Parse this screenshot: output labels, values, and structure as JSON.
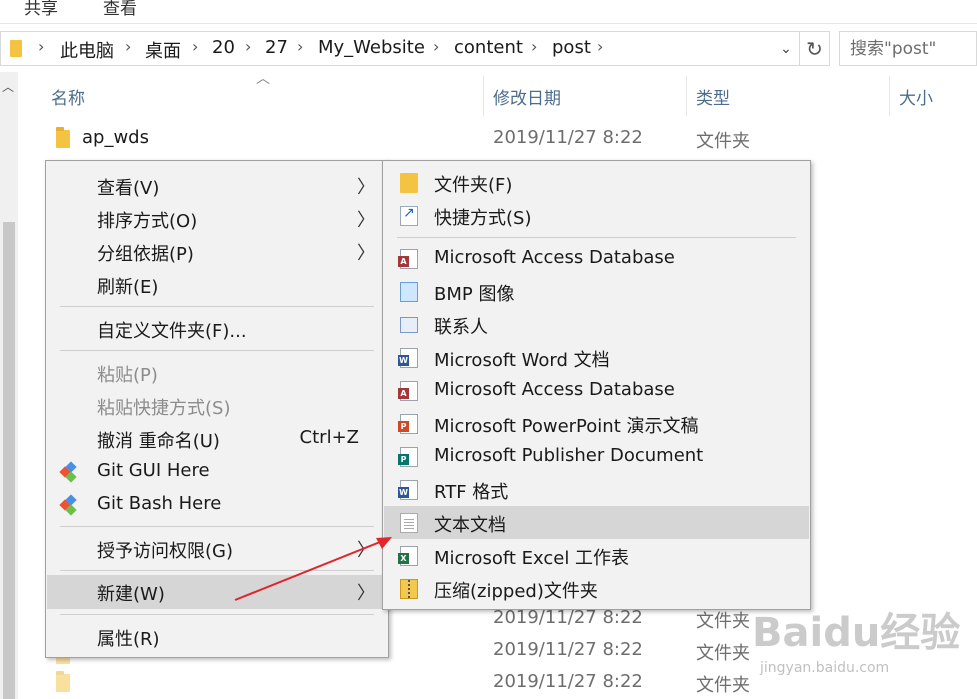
{
  "ribbon": {
    "tabs": [
      "共享",
      "查看"
    ]
  },
  "address": {
    "crumbs": [
      "此电脑",
      "桌面",
      "20",
      "27",
      "My_Website",
      "content",
      "post"
    ]
  },
  "search": {
    "placeholder": "搜索\"post\""
  },
  "columns": {
    "name": "名称",
    "date": "修改日期",
    "type": "类型",
    "size": "大小"
  },
  "files": [
    {
      "name": "ap_wds",
      "date": "2019/11/27 8:22",
      "type": "文件夹"
    },
    {
      "name": "",
      "date": "2019/11/27 8:22",
      "type": "文件夹"
    },
    {
      "name": "",
      "date": "2019/11/27 8:22",
      "type": "文件夹"
    },
    {
      "name": "",
      "date": "2019/11/27 8:22",
      "type": "文件夹"
    }
  ],
  "context_menu": {
    "view": "查看(V)",
    "sort": "排序方式(O)",
    "group": "分组依据(P)",
    "refresh": "刷新(E)",
    "customize": "自定义文件夹(F)...",
    "paste": "粘贴(P)",
    "paste_shortcut": "粘贴快捷方式(S)",
    "undo": "撤消 重命名(U)",
    "undo_shortcut": "Ctrl+Z",
    "git_gui": "Git GUI Here",
    "git_bash": "Git Bash Here",
    "give_access": "授予访问权限(G)",
    "new": "新建(W)",
    "properties": "属性(R)"
  },
  "new_submenu": {
    "folder": "文件夹(F)",
    "shortcut": "快捷方式(S)",
    "items": [
      {
        "label": "Microsoft Access Database",
        "icon": "access-icon",
        "badge": "A",
        "color": "#a4373a"
      },
      {
        "label": "BMP 图像",
        "icon": "bmp-icon"
      },
      {
        "label": "联系人",
        "icon": "contact-icon"
      },
      {
        "label": "Microsoft Word 文档",
        "icon": "word-icon",
        "badge": "W",
        "color": "#2b579a"
      },
      {
        "label": "Microsoft Access Database",
        "icon": "access-icon",
        "badge": "A",
        "color": "#a4373a"
      },
      {
        "label": "Microsoft PowerPoint 演示文稿",
        "icon": "powerpoint-icon",
        "badge": "P",
        "color": "#d24726"
      },
      {
        "label": "Microsoft Publisher Document",
        "icon": "publisher-icon",
        "badge": "P",
        "color": "#077568"
      },
      {
        "label": "RTF 格式",
        "icon": "rtf-icon",
        "badge": "W",
        "color": "#2b579a"
      },
      {
        "label": "文本文档",
        "icon": "text-document-icon"
      },
      {
        "label": "Microsoft Excel 工作表",
        "icon": "excel-icon",
        "badge": "X",
        "color": "#217346"
      },
      {
        "label": "压缩(zipped)文件夹",
        "icon": "zip-folder-icon"
      }
    ]
  },
  "watermark": {
    "brand": "Baidu经验",
    "url": "jingyan.baidu.com"
  },
  "colors": {
    "highlight": "#d6d6d6",
    "menu_bg": "#f2f2f2",
    "arrow": "#e0262a"
  }
}
